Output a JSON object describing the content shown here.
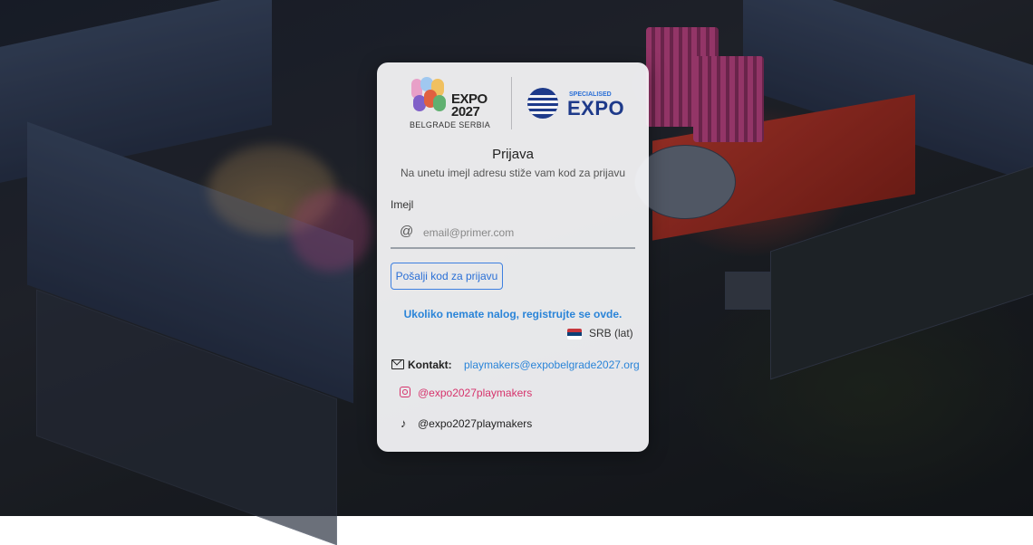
{
  "logos": {
    "expo_year": "EXPO 2027",
    "expo_city": "BELGRADE SERBIA",
    "specialised_small": "SPECIALISED",
    "specialised_word": "EXPO"
  },
  "login": {
    "title": "Prijava",
    "subtitle": "Na unetu imejl adresu stiže vam kod za prijavu",
    "email_label": "Imejl",
    "email_placeholder": "email@primer.com",
    "email_value": "",
    "send_button": "Pošalji kod za prijavu",
    "register_link": "Ukoliko nemate nalog, registrujte se ovde."
  },
  "language": {
    "label": "SRB (lat)",
    "flag_colors": [
      "#c6363c",
      "#0c4076",
      "#ffffff"
    ]
  },
  "contact": {
    "label": "Kontakt:",
    "email": "playmakers@expobelgrade2027.org"
  },
  "social": {
    "instagram": "@expo2027playmakers",
    "tiktok": "@expo2027playmakers"
  },
  "colors": {
    "accent": "#2a84d8",
    "instagram": "#d6336c",
    "button_border": "#3d7fe0"
  }
}
